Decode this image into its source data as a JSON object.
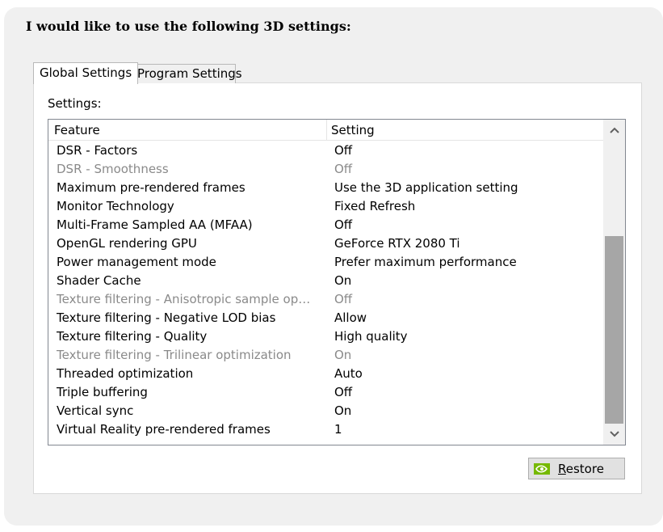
{
  "heading": "I would like to use the following 3D settings:",
  "tabs": [
    {
      "label": "Global Settings",
      "active": true
    },
    {
      "label": "Program Settings",
      "active": false
    }
  ],
  "settings_label": "Settings:",
  "columns": {
    "feature": "Feature",
    "setting": "Setting"
  },
  "rows": [
    {
      "feature": "DSR - Factors",
      "setting": "Off",
      "disabled": false
    },
    {
      "feature": "DSR - Smoothness",
      "setting": "Off",
      "disabled": true
    },
    {
      "feature": "Maximum pre-rendered frames",
      "setting": "Use the 3D application setting",
      "disabled": false
    },
    {
      "feature": "Monitor Technology",
      "setting": "Fixed Refresh",
      "disabled": false
    },
    {
      "feature": "Multi-Frame Sampled AA (MFAA)",
      "setting": "Off",
      "disabled": false
    },
    {
      "feature": "OpenGL rendering GPU",
      "setting": "GeForce RTX 2080 Ti",
      "disabled": false
    },
    {
      "feature": "Power management mode",
      "setting": "Prefer maximum performance",
      "disabled": false
    },
    {
      "feature": "Shader Cache",
      "setting": "On",
      "disabled": false
    },
    {
      "feature": "Texture filtering - Anisotropic sample opti...",
      "setting": "Off",
      "disabled": true
    },
    {
      "feature": "Texture filtering - Negative LOD bias",
      "setting": "Allow",
      "disabled": false
    },
    {
      "feature": "Texture filtering - Quality",
      "setting": "High quality",
      "disabled": false
    },
    {
      "feature": "Texture filtering - Trilinear optimization",
      "setting": "On",
      "disabled": true
    },
    {
      "feature": "Threaded optimization",
      "setting": "Auto",
      "disabled": false
    },
    {
      "feature": "Triple buffering",
      "setting": "Off",
      "disabled": false
    },
    {
      "feature": "Vertical sync",
      "setting": "On",
      "disabled": false
    },
    {
      "feature": "Virtual Reality pre-rendered frames",
      "setting": "1",
      "disabled": false
    }
  ],
  "restore_button": {
    "label_underlined": "R",
    "label_rest": "estore",
    "icon": "nvidia-logo-icon"
  },
  "colors": {
    "nvidia_green": "#76b900",
    "disabled_text": "#8a8a8a",
    "scroll_thumb": "#a6a6a6"
  }
}
